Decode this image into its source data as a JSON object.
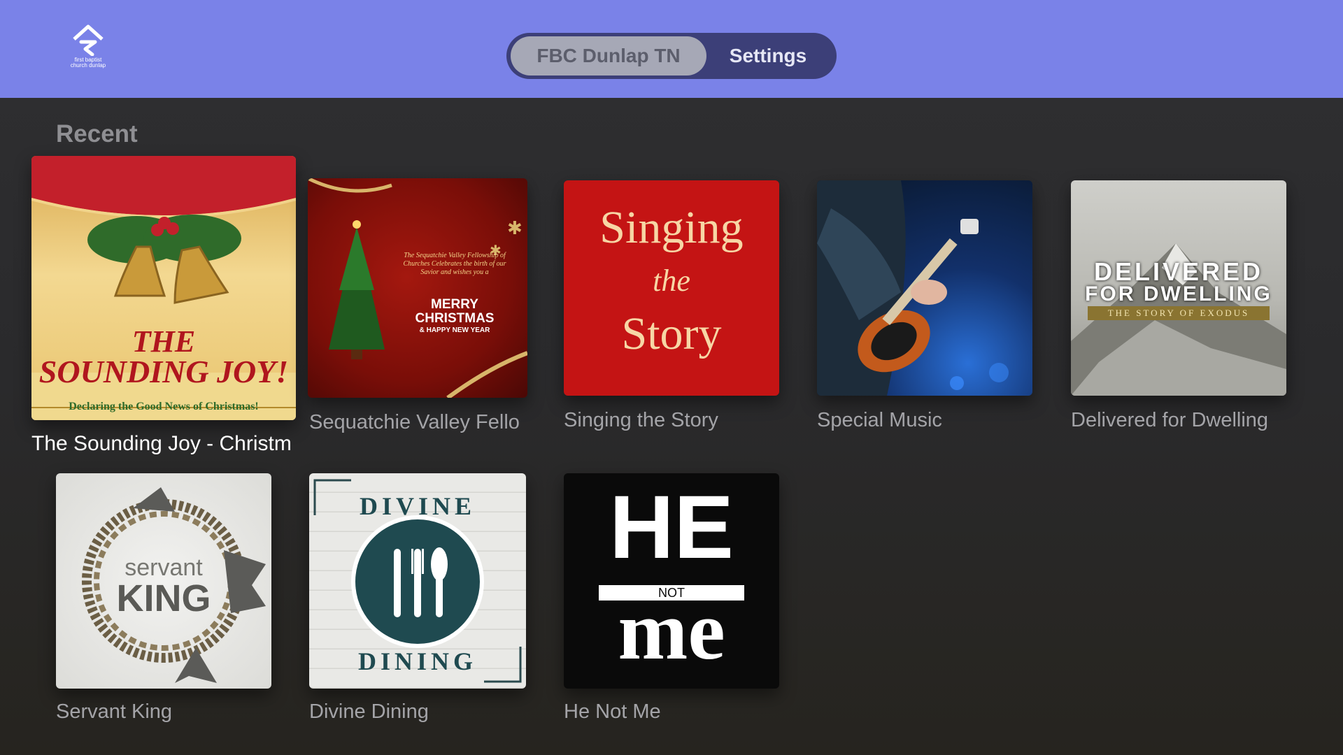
{
  "header": {
    "logo_text": "first baptist\nchurch dunlap",
    "tabs": [
      {
        "label": "FBC Dunlap TN",
        "selected": true
      },
      {
        "label": "Settings",
        "selected": false
      }
    ],
    "bar_color": "#7a82e8"
  },
  "recent": {
    "title": "Recent",
    "items": [
      {
        "title": "The Sounding Joy - Christm",
        "focused": true,
        "art": {
          "line1": "THE",
          "line2": "SOUNDING JOY!",
          "tagline": "Declaring the Good News of Christmas!"
        }
      },
      {
        "title": "Sequatchie Valley Fello",
        "art": {
          "small": "The Sequatchie Valley Fellowship of Churches Celebrates the birth of our Savior and wishes you a",
          "merry": "MERRY",
          "christmas": "CHRISTMAS",
          "newyear": "& HAPPY NEW YEAR"
        }
      },
      {
        "title": "Singing the Story",
        "art": {
          "w1": "Singing",
          "w2": "the",
          "w3": "Story"
        }
      },
      {
        "title": "Special Music",
        "art": {}
      },
      {
        "title": "Delivered for Dwelling",
        "art": {
          "l1": "DELIVERED",
          "l2": "FOR DWELLING",
          "l3": "THE STORY OF EXODUS"
        }
      },
      {
        "title": "Servant King",
        "art": {
          "w1": "servant",
          "w2": "KING"
        }
      },
      {
        "title": "Divine Dining",
        "art": {
          "top": "DIVINE",
          "bottom": "DINING"
        }
      },
      {
        "title": "He Not Me",
        "art": {
          "he": "HE",
          "not": "NOT",
          "me": "me"
        }
      }
    ]
  }
}
